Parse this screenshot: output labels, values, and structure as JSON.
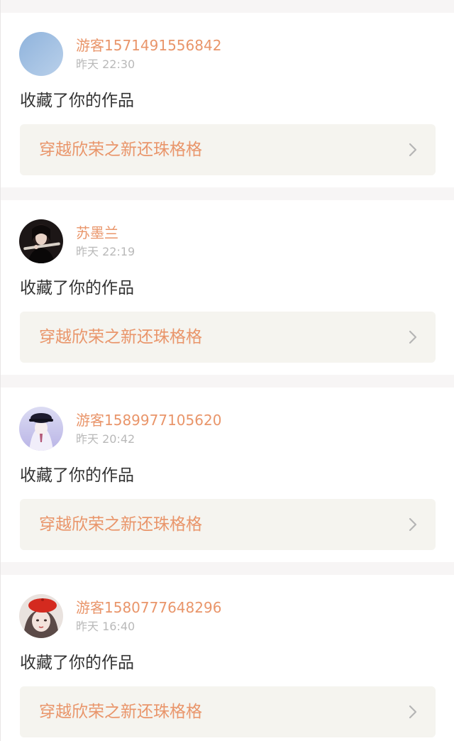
{
  "feed": [
    {
      "username": "游客1571491556842",
      "timestamp": "昨天 22:30",
      "action": "收藏了你的作品",
      "work_title": "穿越欣荣之新还珠格格",
      "avatar": "blue-sky-avatar"
    },
    {
      "username": "苏墨兰",
      "timestamp": "昨天 22:19",
      "action": "收藏了你的作品",
      "work_title": "穿越欣荣之新还珠格格",
      "avatar": "violinist-avatar"
    },
    {
      "username": "游客1589977105620",
      "timestamp": "昨天 20:42",
      "action": "收藏了你的作品",
      "work_title": "穿越欣荣之新还珠格格",
      "avatar": "cap-girl-avatar"
    },
    {
      "username": "游客1580777648296",
      "timestamp": "昨天 16:40",
      "action": "收藏了你的作品",
      "work_title": "穿越欣荣之新还珠格格",
      "avatar": "red-beret-avatar"
    }
  ],
  "colors": {
    "accent": "#e9956a",
    "muted": "#b9b9b9",
    "text": "#333333",
    "link_bg": "#f5f4ef",
    "page_bg": "#f7f5f5"
  }
}
